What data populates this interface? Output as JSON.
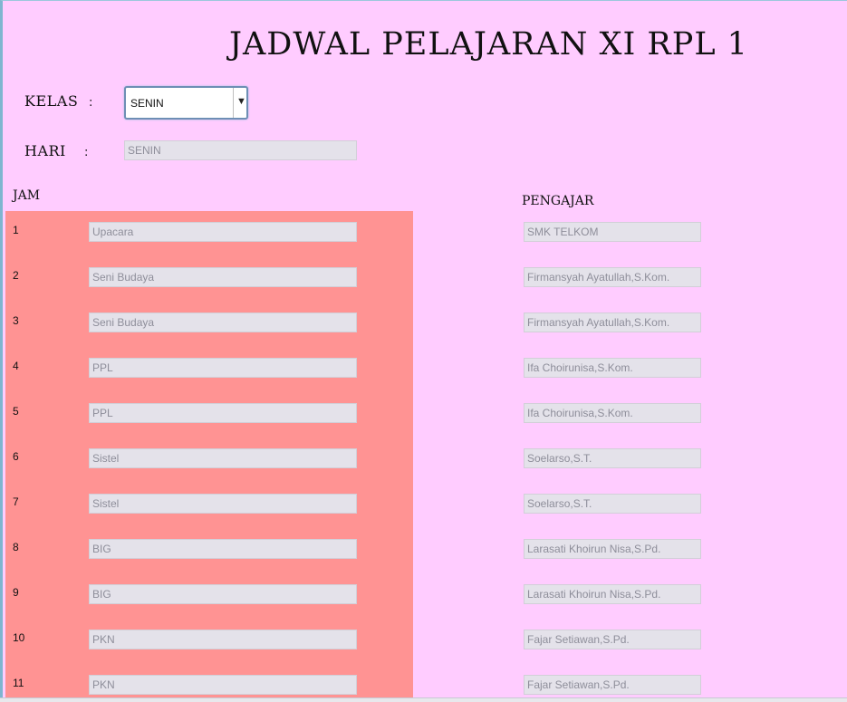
{
  "title": "JADWAL PELAJARAN XI RPL 1",
  "kelas": {
    "label": "KELAS",
    "colon": ":",
    "selected": "SENIN",
    "arrow": "▼"
  },
  "hari": {
    "label": "HARI",
    "colon": ":",
    "value": "SENIN"
  },
  "headers": {
    "jam": "JAM",
    "pengajar": "PENGAJAR"
  },
  "rows": [
    {
      "jam": "1",
      "mapel": "Upacara",
      "pengajar": "SMK TELKOM"
    },
    {
      "jam": "2",
      "mapel": "Seni Budaya",
      "pengajar": "Firmansyah Ayatullah,S.Kom."
    },
    {
      "jam": "3",
      "mapel": "Seni Budaya",
      "pengajar": "Firmansyah Ayatullah,S.Kom."
    },
    {
      "jam": "4",
      "mapel": "PPL",
      "pengajar": "Ifa Choirunisa,S.Kom."
    },
    {
      "jam": "5",
      "mapel": "PPL",
      "pengajar": "Ifa Choirunisa,S.Kom."
    },
    {
      "jam": "6",
      "mapel": "Sistel",
      "pengajar": "Soelarso,S.T."
    },
    {
      "jam": "7",
      "mapel": "Sistel",
      "pengajar": "Soelarso,S.T."
    },
    {
      "jam": "8",
      "mapel": "BIG",
      "pengajar": "Larasati Khoirun Nisa,S.Pd."
    },
    {
      "jam": "9",
      "mapel": "BIG",
      "pengajar": "Larasati Khoirun Nisa,S.Pd."
    },
    {
      "jam": "10",
      "mapel": "PKN",
      "pengajar": "Fajar Setiawan,S.Pd."
    },
    {
      "jam": "11",
      "mapel": "PKN",
      "pengajar": "Fajar Setiawan,S.Pd."
    }
  ],
  "colors": {
    "background": "#ffccff",
    "jam_panel": "#ff9393",
    "field_bg": "#e4e2ea",
    "field_text": "#8e8e9a"
  }
}
